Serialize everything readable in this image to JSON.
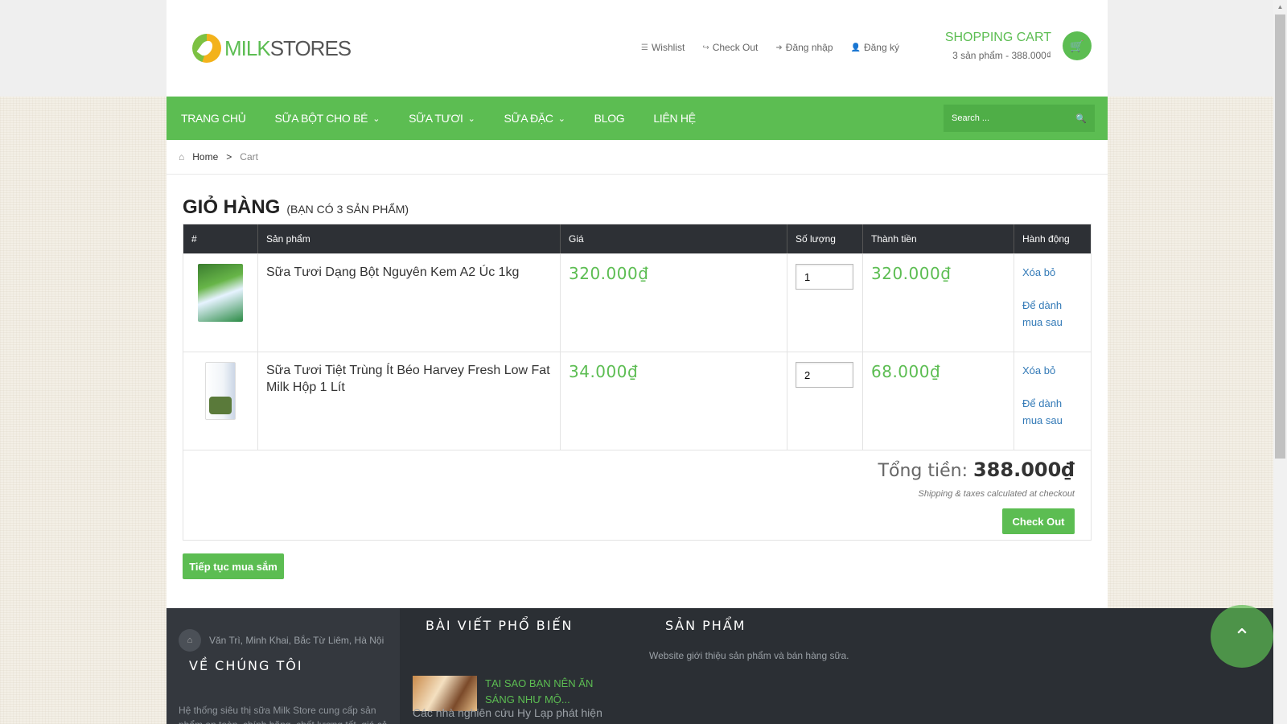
{
  "header": {
    "logo_left": "MILK",
    "logo_right": "STORES",
    "links": [
      {
        "label": "Wishlist",
        "icon": "list-icon"
      },
      {
        "label": "Check Out",
        "icon": "share-icon"
      },
      {
        "label": "Đăng nhập",
        "icon": "sign-in-icon"
      },
      {
        "label": "Đăng ký",
        "icon": "user-plus-icon"
      }
    ],
    "cart_title": "SHOPPING CART",
    "cart_summary": "3 sản phẩm - 388.000₫"
  },
  "nav": {
    "items": [
      "TRANG CHỦ",
      "SỮA BỘT CHO BÉ",
      "SỮA TƯƠI",
      "SỮA ĐẶC",
      "BLOG",
      "LIÊN HỆ"
    ],
    "search_placeholder": "Search ..."
  },
  "breadcrumb": {
    "home": "Home",
    "separator": ">",
    "current": "Cart"
  },
  "page": {
    "title": "GIỎ HÀNG",
    "subtitle": "(BẠN CÓ 3 SẢN PHẨM)"
  },
  "table": {
    "headers": [
      "#",
      "Sản phẩm",
      "Giá",
      "Số lượng",
      "Thành tiền",
      "Hành động"
    ],
    "rows": [
      {
        "name": "Sữa Tươi Dạng Bột Nguyên Kem A2 Úc 1kg",
        "price": "320.000₫",
        "qty": "1",
        "subtotal": "320.000₫",
        "remove": "Xóa bỏ",
        "save": "Để dành mua sau"
      },
      {
        "name": "Sữa Tươi Tiệt Trùng Ít Béo Harvey Fresh Low Fat Milk Hộp 1 Lít",
        "price": "34.000₫",
        "qty": "2",
        "subtotal": "68.000₫",
        "remove": "Xóa bỏ",
        "save": "Để dành mua sau"
      }
    ],
    "total_label": "Tổng tiền:",
    "total_value": "388.000₫",
    "shipping_note": "Shipping & taxes calculated at checkout",
    "checkout": "Check Out"
  },
  "continue_label": "Tiếp tục mua sắm",
  "footer": {
    "address": "Văn Trì, Minh Khai, Bắc Từ Liêm, Hà Nội",
    "about_heading": "VỀ CHÚNG TÔI",
    "about_text": "Hệ thống siêu thị sữa Milk Store cung cấp sản phẩm an toàn, chính hãng, chất lượng tốt, giá cả",
    "posts_heading": "BÀI VIẾT PHỔ BIẾN",
    "post_title": "TẠI SAO BẠN NÊN ĂN SÁNG NHƯ MỘ...",
    "post_desc": "Các nhà nghiên cứu Hy Lạp phát hiện",
    "products_heading": "SẢN PHẨM",
    "products_text": "Website giới thiệu sản phẩm và bán hàng sữa."
  },
  "colors": {
    "accent": "#5cbd52",
    "dark": "#2d3035",
    "link": "#337ab7"
  }
}
